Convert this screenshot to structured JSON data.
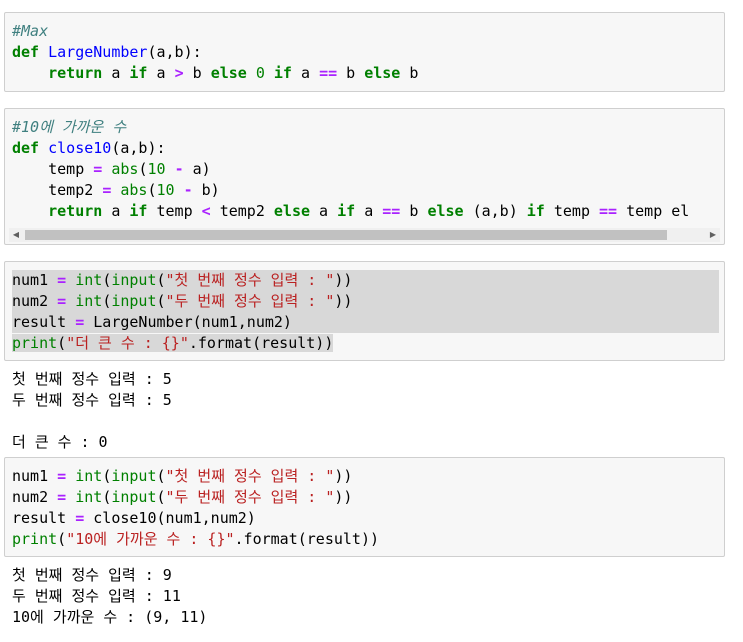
{
  "cells": {
    "max_fn": {
      "comment": "#Max",
      "def_kw": "def",
      "fn_name": "LargeNumber",
      "params": "(a,b):",
      "ret_kw": "return",
      "l3_a": " a ",
      "if1": "if",
      "l3_b": " a ",
      "gt": ">",
      "l3_c": " b ",
      "else1": "else",
      "zero": "0",
      "if2": "if",
      "l3_d": " a ",
      "eq": "==",
      "l3_e": " b ",
      "else2": "else",
      "l3_f": " b"
    },
    "close10_fn": {
      "comment": "#10에 가까운 수",
      "def_kw": "def",
      "fn_name": "close10",
      "params": "(a,b):",
      "l2_var": "temp ",
      "l2_eq": "=",
      "l2_abs": "abs",
      "l2_open": "(",
      "l2_ten": "10",
      "l2_minus": "-",
      "l2_tail": " a)",
      "l3_var": "temp2 ",
      "l3_eq": "=",
      "l3_abs": "abs",
      "l3_open": "(",
      "l3_ten": "10",
      "l3_minus": "-",
      "l3_tail": " b)",
      "ret_kw": "return",
      "r_a": " a ",
      "if1": "if",
      "r_b": " temp ",
      "lt": "<",
      "r_c": " temp2 ",
      "else1": "else",
      "r_d": " a ",
      "if2": "if",
      "r_e": " a ",
      "eq": "==",
      "r_f": " b ",
      "else2": "else",
      "r_g": " (a,b) ",
      "if3": "if",
      "r_h": " temp ",
      "eq2": "==",
      "r_i": " temp el"
    },
    "run1": {
      "l1_var": "num1 ",
      "l1_eq": "=",
      "l1_int": "int",
      "l1_open": "(",
      "l1_input": "input",
      "l1_open2": "(",
      "l1_str": "\"첫 번째 정수 입력 : \"",
      "l1_close": "))",
      "l2_var": "num2 ",
      "l2_eq": "=",
      "l2_int": "int",
      "l2_open": "(",
      "l2_input": "input",
      "l2_open2": "(",
      "l2_str": "\"두 번째 정수 입력 : \"",
      "l2_close": "))",
      "l3_var": "result ",
      "l3_eq": "=",
      "l3_call": " LargeNumber(num1,num2)",
      "l4_print": "print",
      "l4_open": "(",
      "l4_str": "\"더 큰 수 : {}\"",
      "l4_tail": ".format(result))",
      "output": [
        "첫 번째 정수 입력 : 5",
        "두 번째 정수 입력 : 5",
        "",
        "더 큰 수 : 0"
      ]
    },
    "run2": {
      "l1_var": "num1 ",
      "l1_eq": "=",
      "l1_int": "int",
      "l1_open": "(",
      "l1_input": "input",
      "l1_open2": "(",
      "l1_str": "\"첫 번째 정수 입력 : \"",
      "l1_close": "))",
      "l2_var": "num2 ",
      "l2_eq": "=",
      "l2_int": "int",
      "l2_open": "(",
      "l2_input": "input",
      "l2_open2": "(",
      "l2_str": "\"두 번째 정수 입력 : \"",
      "l2_close": "))",
      "l3_var": "result ",
      "l3_eq": "=",
      "l3_call": " close10(num1,num2)",
      "l4_print": "print",
      "l4_open": "(",
      "l4_str": "\"10에 가까운 수 : {}\"",
      "l4_tail": ".format(result))",
      "output": [
        "첫 번째 정수 입력 : 9",
        "두 번째 정수 입력 : 11",
        "10에 가까운 수 : (9, 11)"
      ]
    }
  },
  "scrollbar": {
    "left_arrow": "◀",
    "right_arrow": "▶"
  }
}
